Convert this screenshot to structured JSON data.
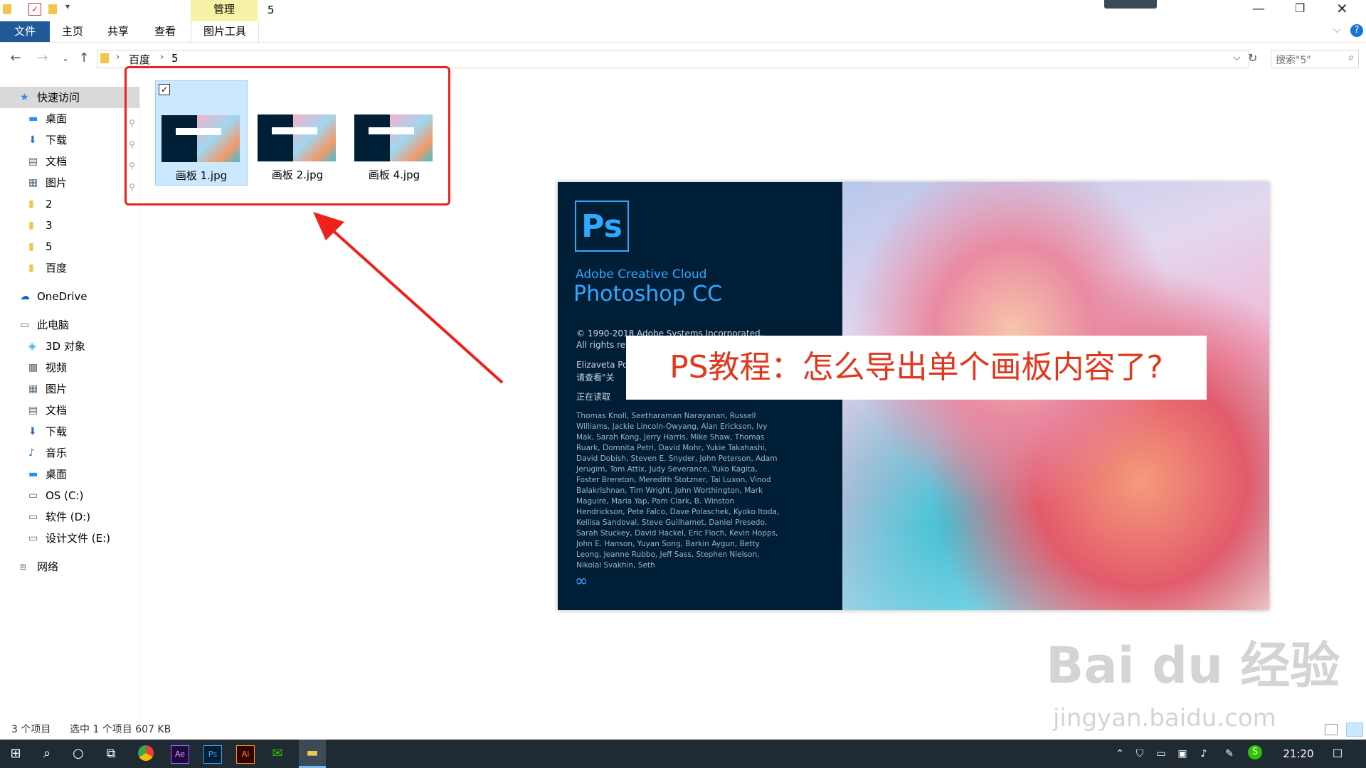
{
  "window": {
    "tab_manage": "管理",
    "title": "5",
    "tab_file": "文件",
    "tab_home": "主页",
    "tab_share": "共享",
    "tab_view": "查看",
    "tab_picture_tools": "图片工具"
  },
  "address": {
    "crumbs": [
      "百度",
      "5"
    ],
    "search_placeholder": "搜索\"5\""
  },
  "sidebar": {
    "items": [
      {
        "label": "快速访问",
        "icon": "star-icon",
        "selected": true
      },
      {
        "label": "桌面",
        "icon": "desktop-icon",
        "pinned": true
      },
      {
        "label": "下载",
        "icon": "download-icon",
        "pinned": true
      },
      {
        "label": "文档",
        "icon": "document-icon",
        "pinned": true
      },
      {
        "label": "图片",
        "icon": "picture-icon",
        "pinned": true
      },
      {
        "label": "2",
        "icon": "folder-icon"
      },
      {
        "label": "3",
        "icon": "folder-icon"
      },
      {
        "label": "5",
        "icon": "folder-icon"
      },
      {
        "label": "百度",
        "icon": "folder-icon"
      },
      {
        "label": "OneDrive",
        "icon": "cloud-icon"
      },
      {
        "label": "此电脑",
        "icon": "computer-icon"
      },
      {
        "label": "3D 对象",
        "icon": "cube-icon"
      },
      {
        "label": "视频",
        "icon": "video-icon"
      },
      {
        "label": "图片",
        "icon": "picture-icon"
      },
      {
        "label": "文档",
        "icon": "document-icon"
      },
      {
        "label": "下载",
        "icon": "download-icon"
      },
      {
        "label": "音乐",
        "icon": "music-icon"
      },
      {
        "label": "桌面",
        "icon": "desktop-icon"
      },
      {
        "label": "OS (C:)",
        "icon": "drive-icon"
      },
      {
        "label": "软件 (D:)",
        "icon": "drive-icon"
      },
      {
        "label": "设计文件 (E:)",
        "icon": "drive-icon"
      },
      {
        "label": "网络",
        "icon": "network-icon"
      }
    ]
  },
  "files": [
    {
      "name": "画板 1.jpg",
      "selected": true
    },
    {
      "name": "画板 2.jpg",
      "selected": false
    },
    {
      "name": "画板 4.jpg",
      "selected": false
    }
  ],
  "splash": {
    "logo": "Ps",
    "cc_label": "Adobe Creative Cloud",
    "product": "Photoshop CC",
    "copyright": "© 1990-2018 Adobe Systems Incorporated.",
    "rights": "All rights re",
    "author": "Elizaveta Po",
    "see_about": "请查看\"关",
    "loading": "正在读取",
    "credits": "Thomas Knoll, Seetharaman Narayanan, Russell Williams, Jackie Lincoln-Owyang, Alan Erickson, Ivy Mak, Sarah Kong, Jerry Harris, Mike Shaw, Thomas Ruark, Domnita Petri, David Mohr, Yukie Takahashi, David Dobish, Steven E. Snyder, John Peterson, Adam Jerugim, Tom Attix, Judy Severance, Yuko Kagita, Foster Brereton, Meredith Stotzner, Tai Luxon, Vinod Balakrishnan, Tim Wright, John Worthington, Mark Maguire, Maria Yap, Pam Clark, B. Winston Hendrickson, Pete Falco, Dave Polaschek, Kyoko Itoda, Kellisa Sandoval, Steve Guilhamet, Daniel Presedo, Sarah Stuckey, David Hackel, Eric Floch, Kevin Hopps, John E. Hanson, Yuyan Song, Barkin Aygun, Betty Leong, Jeanne Rubbo, Jeff Sass, Stephen Nielson, Nikolai Svakhin, Seth"
  },
  "banner": "PS教程：怎么导出单个画板内容了?",
  "status": {
    "count": "3 个项目",
    "selection": "选中 1 个项目  607 KB"
  },
  "watermark": {
    "brand": "Bai du 经验",
    "url": "jingyan.baidu.com"
  },
  "taskbar": {
    "clock": "21:20"
  },
  "colors": {
    "ps_blue": "#31a8ff",
    "ps_bg": "#001e36",
    "highlight_red": "#f0201a",
    "banner_red": "#e2371d",
    "file_tab": "#1f5a96",
    "manage_tab": "#f8f2a6"
  }
}
